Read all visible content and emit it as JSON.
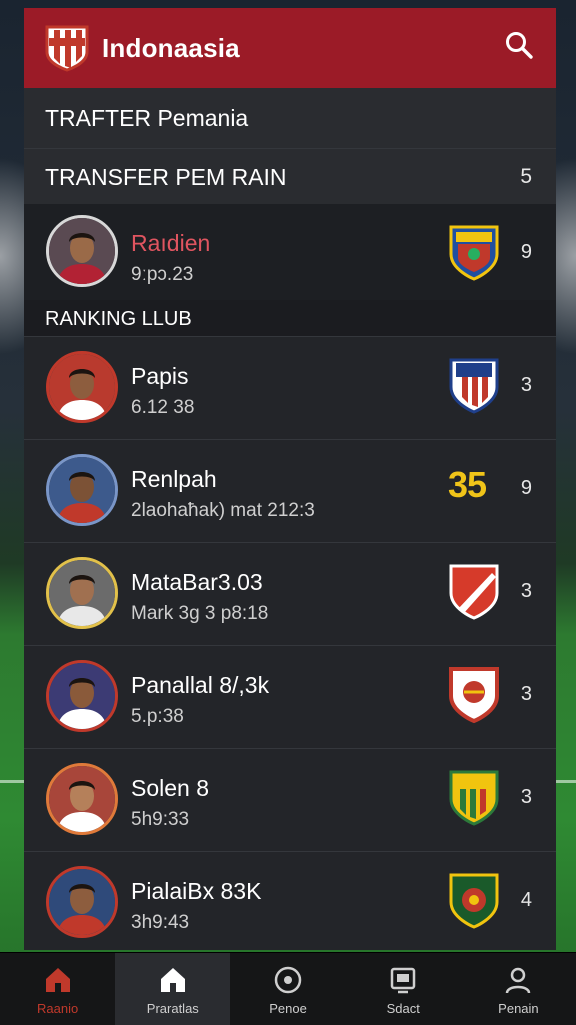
{
  "app": {
    "title": "Indonaasia",
    "accent": "#9b1b27"
  },
  "header": {
    "search_icon": "search-icon"
  },
  "sections": {
    "transfer_title": "TRAFTER Pemania",
    "transfer_subtitle": "TRANSFER PEM RAIN",
    "transfer_count": "5",
    "ranking_title": "RANKING LLUB"
  },
  "featured": {
    "name": "Raıdien",
    "meta": "9ːpɔ.23",
    "count": "9",
    "name_color": "#e05560"
  },
  "players": [
    {
      "name": "Papis",
      "meta": "6.12 38",
      "count": "3"
    },
    {
      "name": "Renlpah",
      "meta": "2laohaħak) mat 212:3",
      "count": "9",
      "badge": "35"
    },
    {
      "name": "MataBar3.03",
      "meta": "Mark 3g 3 p8:18",
      "count": "3"
    },
    {
      "name": "Panallal 8/,3k",
      "meta": "5.p:38",
      "count": "3"
    },
    {
      "name": "Solen 8",
      "meta": "5h9:33",
      "count": "3"
    },
    {
      "name": "PialaiBx 83K",
      "meta": "3h9:43",
      "count": "4"
    }
  ],
  "bottom_nav": [
    {
      "label": "Raanio",
      "icon": "home-icon"
    },
    {
      "label": "Praratlas",
      "icon": "home-icon"
    },
    {
      "label": "Penoe",
      "icon": "record-icon"
    },
    {
      "label": "Sdact",
      "icon": "screen-icon"
    },
    {
      "label": "Penain",
      "icon": "profile-icon"
    }
  ]
}
